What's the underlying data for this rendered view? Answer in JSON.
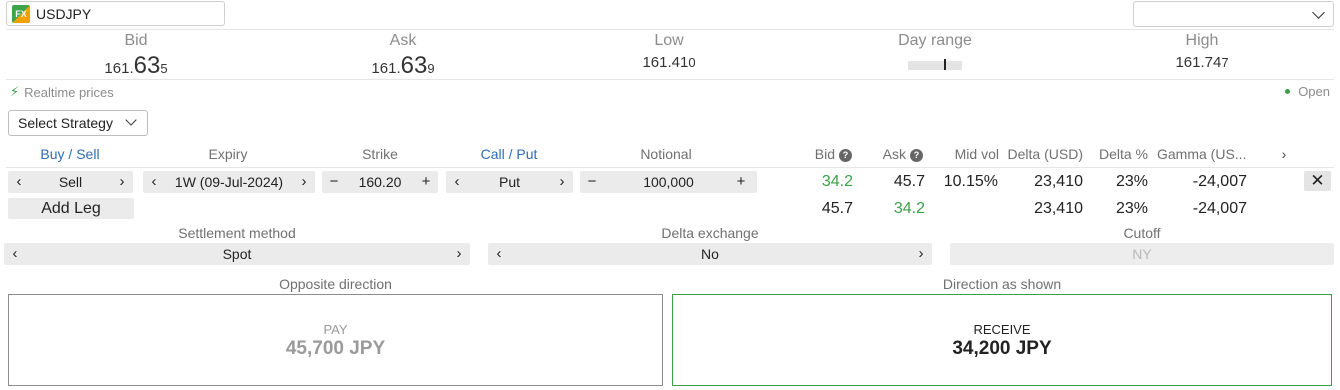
{
  "symbol": {
    "code": "USDJPY",
    "logo_text": "FX"
  },
  "top_right_select": {
    "value": ""
  },
  "quotes": {
    "bid": {
      "label": "Bid",
      "small": "161.",
      "big": "63",
      "pip": "5"
    },
    "ask": {
      "label": "Ask",
      "small": "161.",
      "big": "63",
      "pip": "9"
    },
    "low": {
      "label": "Low",
      "main": "161.41",
      "pip": "0"
    },
    "day_range": {
      "label": "Day range",
      "position": 0.68
    },
    "high": {
      "label": "High",
      "main": "161.74",
      "pip": "7"
    }
  },
  "status": {
    "realtime": "Realtime prices",
    "market": "Open"
  },
  "strategy": {
    "label": "Select Strategy"
  },
  "leg_headers": {
    "buy_sell": "Buy / Sell",
    "expiry": "Expiry",
    "strike": "Strike",
    "call_put": "Call / Put",
    "notional": "Notional",
    "bid": "Bid",
    "ask": "Ask",
    "mid_vol": "Mid vol",
    "delta_usd": "Delta (USD)",
    "delta_pct": "Delta %",
    "gamma": "Gamma (US..."
  },
  "leg": {
    "buy_sell": "Sell",
    "expiry": "1W (09-Jul-2024)",
    "strike": "160.20",
    "call_put": "Put",
    "notional": "100,000",
    "bid": "34.2",
    "ask": "45.7",
    "mid_vol": "10.15%",
    "delta_usd": "23,410",
    "delta_pct": "23%",
    "gamma": "-24,007"
  },
  "totals": {
    "bid": "45.7",
    "ask": "34.2",
    "delta_usd": "23,410",
    "delta_pct": "23%",
    "gamma": "-24,007"
  },
  "add_leg": "Add Leg",
  "settlement": {
    "label": "Settlement method",
    "value": "Spot"
  },
  "delta_exchange": {
    "label": "Delta exchange",
    "value": "No"
  },
  "cutoff": {
    "label": "Cutoff",
    "value": "NY"
  },
  "directions": {
    "opposite": {
      "label": "Opposite direction",
      "action": "PAY",
      "amount": "45,700 JPY"
    },
    "shown": {
      "label": "Direction as shown",
      "action": "RECEIVE",
      "amount": "34,200 JPY"
    }
  },
  "colors": {
    "accent_green": "#3aa14a",
    "link_blue": "#2d6cb5"
  }
}
